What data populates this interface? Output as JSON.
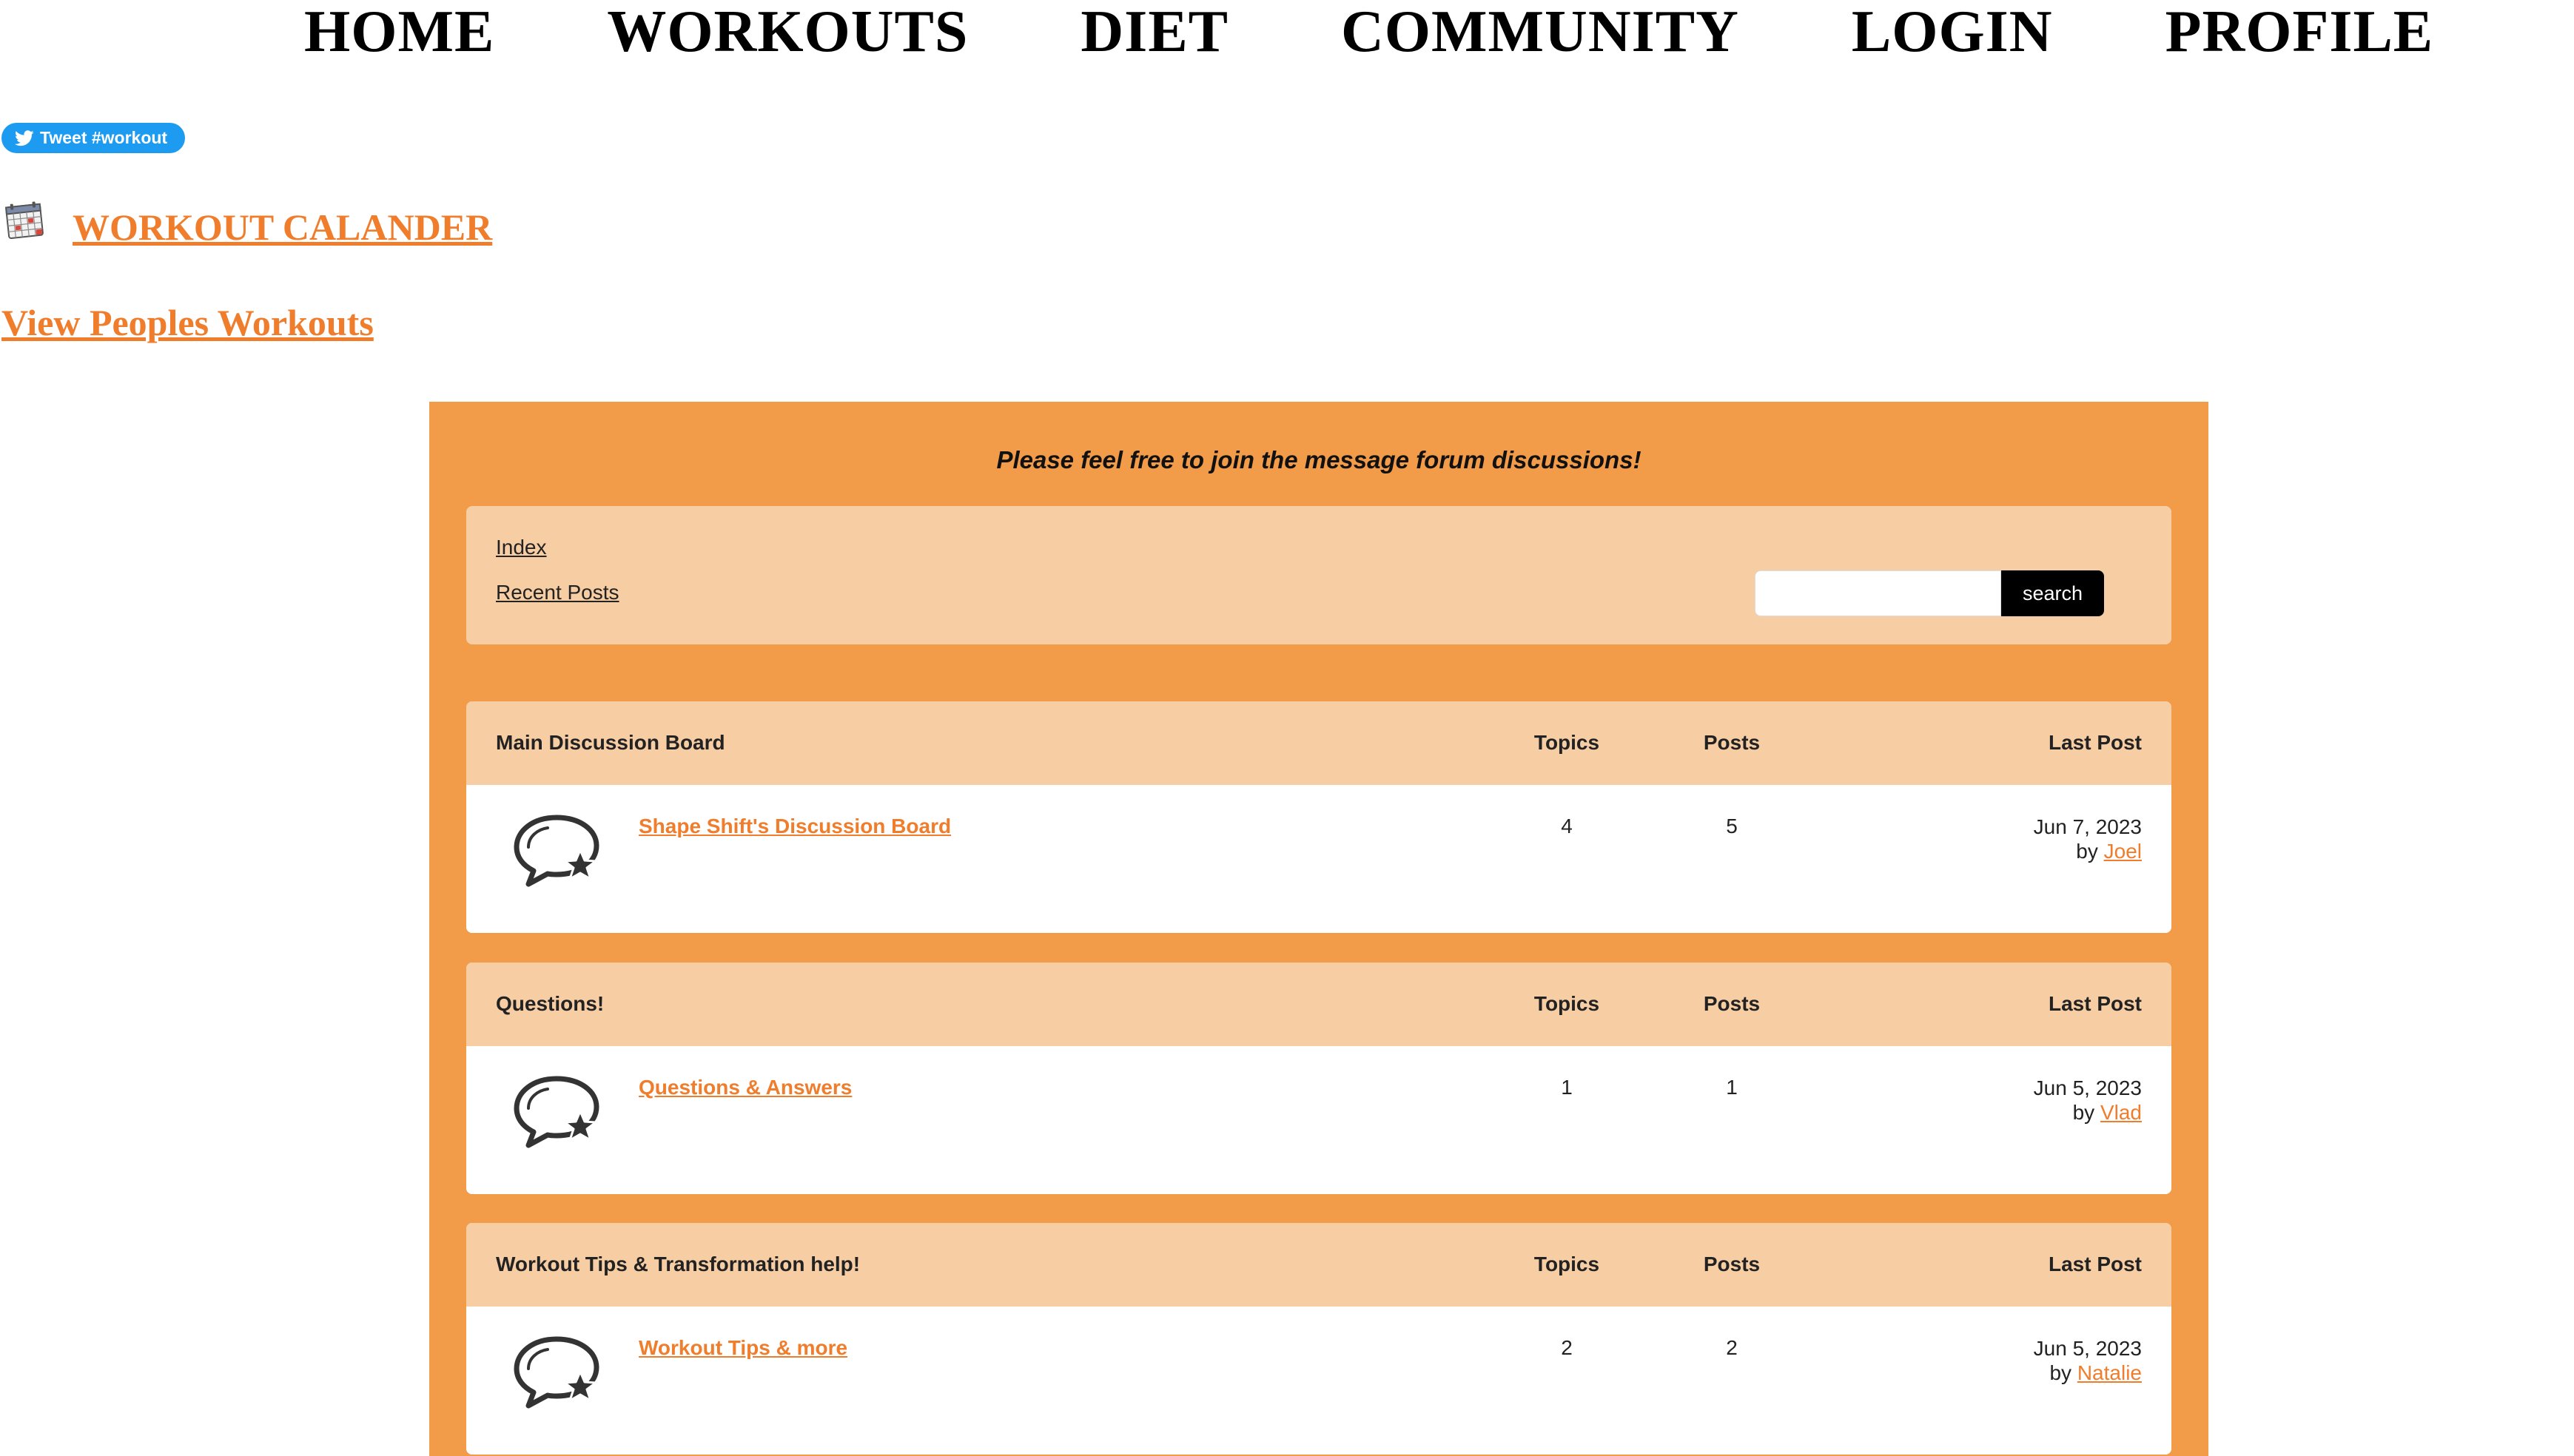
{
  "nav": {
    "items": [
      "HOME",
      "WORKOUTS",
      "DIET",
      "COMMUNITY",
      "LOGIN",
      "PROFILE"
    ]
  },
  "tweet": {
    "label": "Tweet #workout",
    "icon": "twitter-bird-icon",
    "color": "#1d9bf0"
  },
  "calendar": {
    "icon": "calendar-icon",
    "label": "WORKOUT CALANDER"
  },
  "people_workouts": {
    "label": "View Peoples Workouts"
  },
  "forum": {
    "intro": "Please feel free to join the message forum discussions!",
    "nav_links": {
      "index": "Index",
      "recent": "Recent Posts"
    },
    "search": {
      "placeholder": "",
      "value": "",
      "button": "search"
    },
    "colors": {
      "outer": "#f29b48",
      "header": "#f7cda4",
      "link": "#ef7d2c"
    },
    "boards": [
      {
        "title": "Main Discussion Board",
        "col_topics": "Topics",
        "col_posts": "Posts",
        "col_last": "Last Post",
        "forum_name": "Shape Shift's Discussion Board",
        "topics": "4",
        "posts": "5",
        "last_date": "Jun 7, 2023",
        "last_by": "by",
        "last_user": "Joel",
        "icon": "chat-bubble-star-icon"
      },
      {
        "title": "Questions!",
        "col_topics": "Topics",
        "col_posts": "Posts",
        "col_last": "Last Post",
        "forum_name": "Questions & Answers",
        "topics": "1",
        "posts": "1",
        "last_date": "Jun 5, 2023",
        "last_by": "by",
        "last_user": "Vlad",
        "icon": "chat-bubble-star-icon"
      },
      {
        "title": "Workout Tips & Transformation help!",
        "col_topics": "Topics",
        "col_posts": "Posts",
        "col_last": "Last Post",
        "forum_name": "Workout Tips & more",
        "topics": "2",
        "posts": "2",
        "last_date": "Jun 5, 2023",
        "last_by": "by",
        "last_user": "Natalie",
        "icon": "chat-bubble-star-icon"
      }
    ]
  }
}
